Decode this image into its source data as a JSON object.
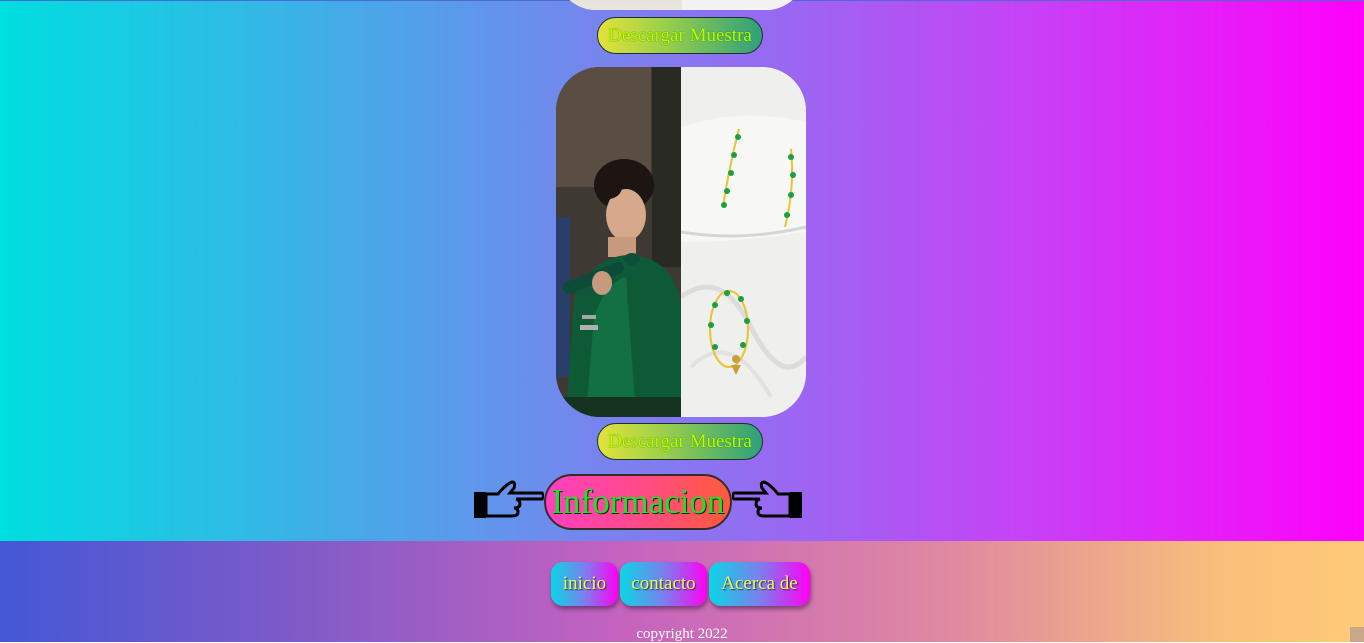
{
  "gallery": {
    "download_label_top": "Descargar Muestra",
    "download_label_bottom": "Descargar Muestra"
  },
  "info": {
    "label": "Informacion",
    "left_icon": "pointing-right-hand-icon",
    "right_icon": "pointing-left-hand-icon"
  },
  "footer": {
    "nav": [
      {
        "label": "inicio"
      },
      {
        "label": "contacto"
      },
      {
        "label": "Acerca de"
      }
    ],
    "copyright": "copyright 2022"
  },
  "colors": {
    "download_text": "#b5ff00",
    "info_text": "#22e02a",
    "nav_text": "#e6ff58"
  }
}
